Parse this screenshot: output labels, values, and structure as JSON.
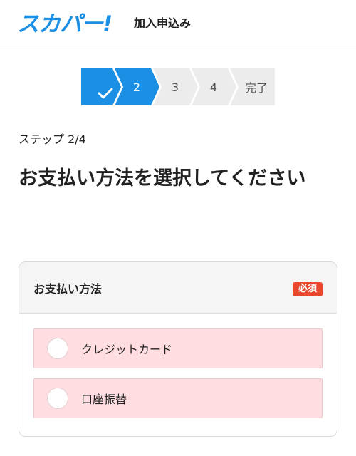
{
  "header": {
    "logo_text": "スカパー!",
    "title": "加入申込み"
  },
  "stepper": {
    "steps": [
      {
        "label": "",
        "icon": "checkmark-icon",
        "state": "done"
      },
      {
        "label": "2",
        "state": "current"
      },
      {
        "label": "3",
        "state": "upcoming"
      },
      {
        "label": "4",
        "state": "upcoming"
      },
      {
        "label": "完了",
        "state": "upcoming"
      }
    ]
  },
  "step_count": "ステップ 2/4",
  "page_title": "お支払い方法を選択してください",
  "payment": {
    "title": "お支払い方法",
    "required_badge": "必須",
    "options": [
      {
        "label": "クレジットカード"
      },
      {
        "label": "口座振替"
      }
    ]
  },
  "colors": {
    "brand": "#1a8fe3",
    "step_active": "#1a8fe3",
    "step_inactive": "#ececec",
    "badge": "#e8472e",
    "option_bg": "#ffdde0"
  }
}
